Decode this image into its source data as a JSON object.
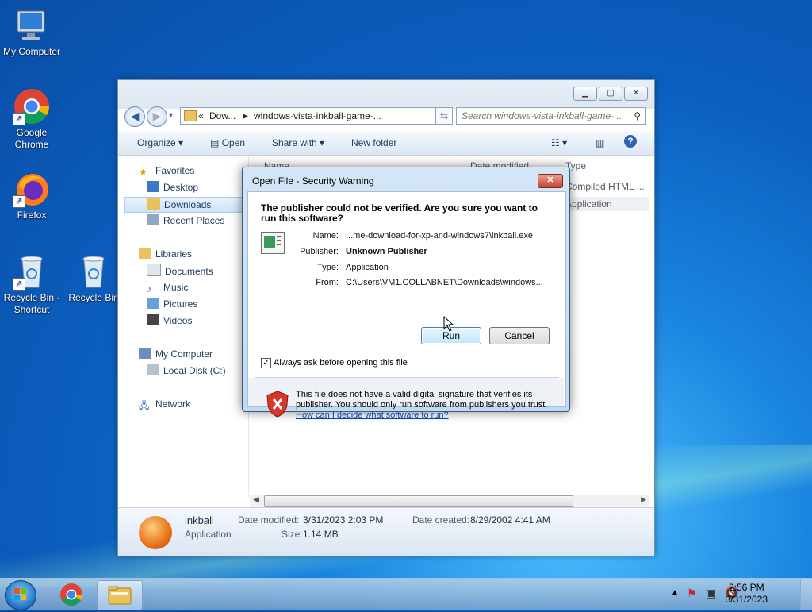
{
  "desktop": {
    "icons": [
      {
        "label": "My Computer"
      },
      {
        "label": "Google Chrome"
      },
      {
        "label": "Firefox"
      },
      {
        "label": "Recycle Bin - Shortcut"
      },
      {
        "label": "Recycle Bin"
      }
    ]
  },
  "explorer": {
    "address": {
      "prefix": "«",
      "crumb1": "Dow...",
      "crumb2": "windows-vista-inkball-game-..."
    },
    "search_placeholder": "Search windows-vista-inkball-game-...",
    "toolbar": {
      "organize": "Organize",
      "open": "Open",
      "share_with": "Share with",
      "new_folder": "New folder"
    },
    "nav": {
      "favorites": "Favorites",
      "desktop": "Desktop",
      "downloads": "Downloads",
      "recent_places": "Recent Places",
      "libraries": "Libraries",
      "documents": "Documents",
      "music": "Music",
      "pictures": "Pictures",
      "videos": "Videos",
      "my_computer": "My Computer",
      "local_disk": "Local Disk (C:)",
      "network": "Network"
    },
    "columns": {
      "name": "Name",
      "date_modified": "Date modified",
      "type": "Type"
    },
    "rows": [
      {
        "type": "Compiled HTML ..."
      },
      {
        "type": "Application"
      }
    ],
    "details": {
      "name": "inkball",
      "kind": "Application",
      "date_modified_label": "Date modified:",
      "date_modified": "3/31/2023 2:03 PM",
      "size_label": "Size:",
      "size": "1.14 MB",
      "date_created_label": "Date created:",
      "date_created": "8/29/2002 4:41 AM"
    }
  },
  "dialog": {
    "title": "Open File - Security Warning",
    "heading": "The publisher could not be verified.  Are you sure you want to run this software?",
    "fields": {
      "name_label": "Name:",
      "name": "...me-download-for-xp-and-windows7\\inkball.exe",
      "publisher_label": "Publisher:",
      "publisher": "Unknown Publisher",
      "type_label": "Type:",
      "type": "Application",
      "from_label": "From:",
      "from": "C:\\Users\\VM1.COLLABNET\\Downloads\\windows..."
    },
    "run_label": "Run",
    "cancel_label": "Cancel",
    "always_ask_label": "Always ask before opening this file",
    "warning_text": "This file does not have a valid digital signature that verifies its publisher.  You should only run software from publishers you trust.",
    "help_link": "How can I decide what software to run?"
  },
  "taskbar": {
    "time": "2:56 PM",
    "date": "3/31/2023"
  }
}
